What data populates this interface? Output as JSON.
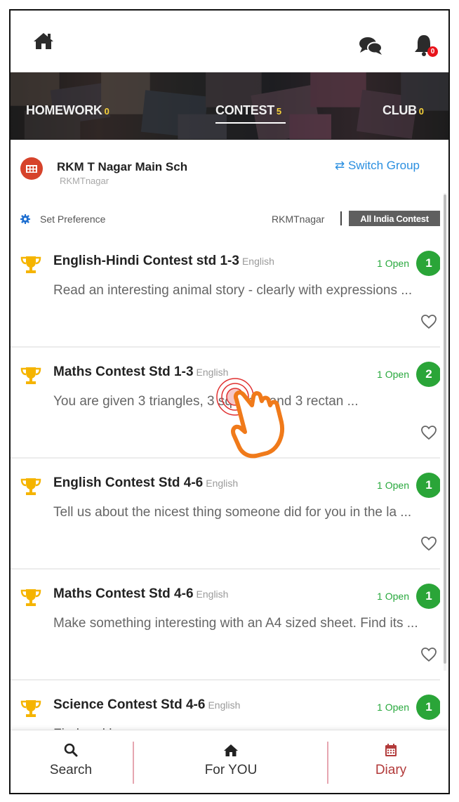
{
  "header": {
    "notification_count": "0"
  },
  "tabs": [
    {
      "label": "HOMEWORK",
      "count": "0"
    },
    {
      "label": "CONTEST",
      "count": "5"
    },
    {
      "label": "CLUB",
      "count": "0"
    }
  ],
  "active_tab": "CONTEST",
  "group": {
    "name": "RKM T Nagar Main Sch",
    "handle": "RKMTnagar",
    "switch_label": "⇄ Switch Group"
  },
  "preference": {
    "label": "Set Preference",
    "scope_left": "RKMTnagar",
    "scope_right": "All India Contest"
  },
  "contests": [
    {
      "title": "English-Hindi Contest std 1-3",
      "language": "English",
      "status": "1 Open",
      "count": "1",
      "description": "Read an interesting animal story - clearly with expressions ..."
    },
    {
      "title": "Maths Contest Std 1-3",
      "language": "English",
      "status": "1 Open",
      "count": "2",
      "description": "You are given 3 triangles, 3 squares and 3 rectan ..."
    },
    {
      "title": "English Contest Std 4-6",
      "language": "English",
      "status": "1 Open",
      "count": "1",
      "description": "Tell us about the nicest thing someone did for you in the la ..."
    },
    {
      "title": "Maths Contest Std 4-6",
      "language": "English",
      "status": "1 Open",
      "count": "1",
      "description": "Make something interesting with an A4 sized sheet. Find its ..."
    },
    {
      "title": "Science Contest Std 4-6",
      "language": "English",
      "status": "1 Open",
      "count": "1",
      "description": "Find and l..."
    }
  ],
  "bottom_nav": {
    "search": "Search",
    "for_you": "For YOU",
    "diary": "Diary"
  },
  "colors": {
    "accent_blue": "#2a8fe0",
    "open_green": "#2aa538",
    "trophy_gold": "#f5b400",
    "diary_red": "#b23a3a",
    "pointer_orange": "#f07a1a"
  }
}
